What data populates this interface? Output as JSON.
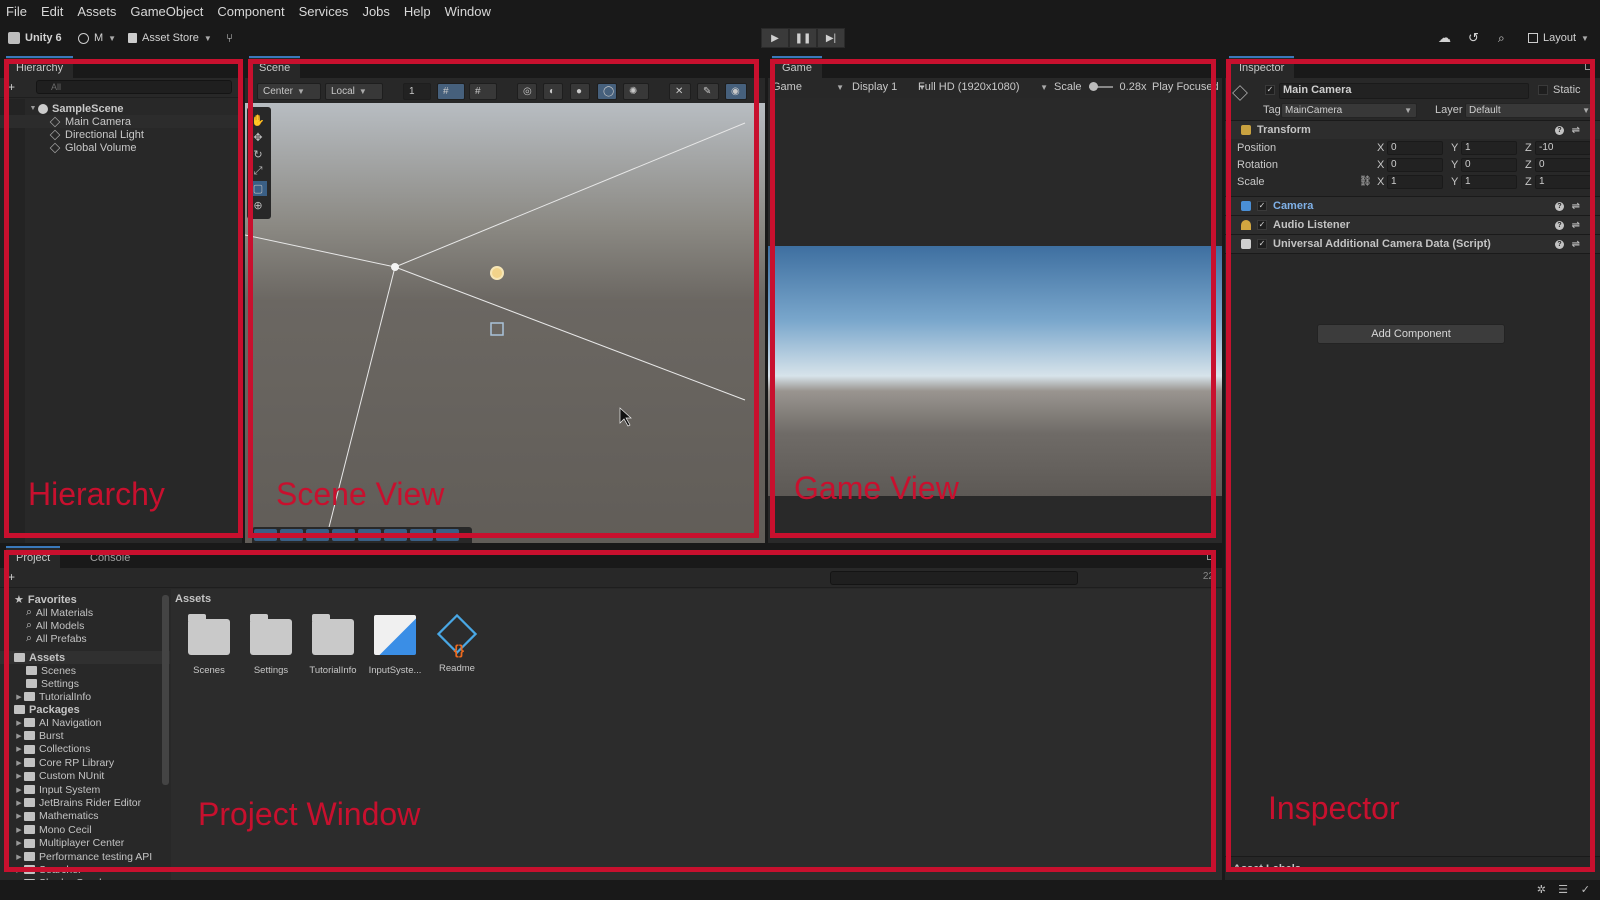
{
  "menubar": {
    "items": [
      "File",
      "Edit",
      "Assets",
      "GameObject",
      "Component",
      "Services",
      "Jobs",
      "Help",
      "Window"
    ]
  },
  "toolbar": {
    "app_label": "Unity 6",
    "account_label": "M",
    "asset_store_label": "Asset Store",
    "layout_label": "Layout"
  },
  "hierarchy": {
    "tab_label": "Hierarchy",
    "search_placeholder": "All",
    "scene_name": "SampleScene",
    "items": [
      "Main Camera",
      "Directional Light",
      "Global Volume"
    ]
  },
  "scene": {
    "tab_label": "Scene",
    "pivot_label": "Center",
    "space_label": "Local",
    "snap_value": "1"
  },
  "game": {
    "tab_label": "Game",
    "mode_label": "Game",
    "display_label": "Display 1",
    "resolution_label": "Full HD (1920x1080)",
    "scale_label": "Scale",
    "scale_value": "0.28x",
    "play_focus_label": "Play Focused"
  },
  "inspector": {
    "tab_label": "Inspector",
    "object_name": "Main Camera",
    "static_label": "Static",
    "tag_label": "Tag",
    "tag_value": "MainCamera",
    "layer_label": "Layer",
    "layer_value": "Default",
    "transform_label": "Transform",
    "position_label": "Position",
    "rotation_label": "Rotation",
    "scale_label": "Scale",
    "axis_x": "X",
    "axis_y": "Y",
    "axis_z": "Z",
    "position": {
      "x": "0",
      "y": "1",
      "z": "-10"
    },
    "rotation": {
      "x": "0",
      "y": "0",
      "z": "0"
    },
    "scale": {
      "x": "1",
      "y": "1",
      "z": "1"
    },
    "components": [
      "Camera",
      "Audio Listener",
      "Universal Additional Camera Data (Script)"
    ],
    "add_component_label": "Add Component",
    "asset_labels_label": "Asset Labels"
  },
  "project": {
    "tab_label": "Project",
    "console_tab_label": "Console",
    "favorites_label": "Favorites",
    "favorites": [
      "All Materials",
      "All Models",
      "All Prefabs"
    ],
    "assets_label": "Assets",
    "asset_folders": [
      "Scenes",
      "Settings",
      "TutorialInfo"
    ],
    "packages_label": "Packages",
    "packages": [
      "AI Navigation",
      "Burst",
      "Collections",
      "Core RP Library",
      "Custom NUnit",
      "Input System",
      "JetBrains Rider Editor",
      "Mathematics",
      "Mono Cecil",
      "Multiplayer Center",
      "Performance testing API",
      "Searcher",
      "Shader Graph"
    ],
    "breadcrumb": "Assets",
    "grid_items": [
      "Scenes",
      "Settings",
      "TutorialInfo",
      "InputSyste...",
      "Readme"
    ],
    "hidden_count": "22"
  },
  "annotations": {
    "hierarchy": "Hierarchy",
    "scene": "Scene View",
    "game": "Game View",
    "project": "Project Window",
    "inspector": "Inspector",
    "color": "#c8102e"
  }
}
